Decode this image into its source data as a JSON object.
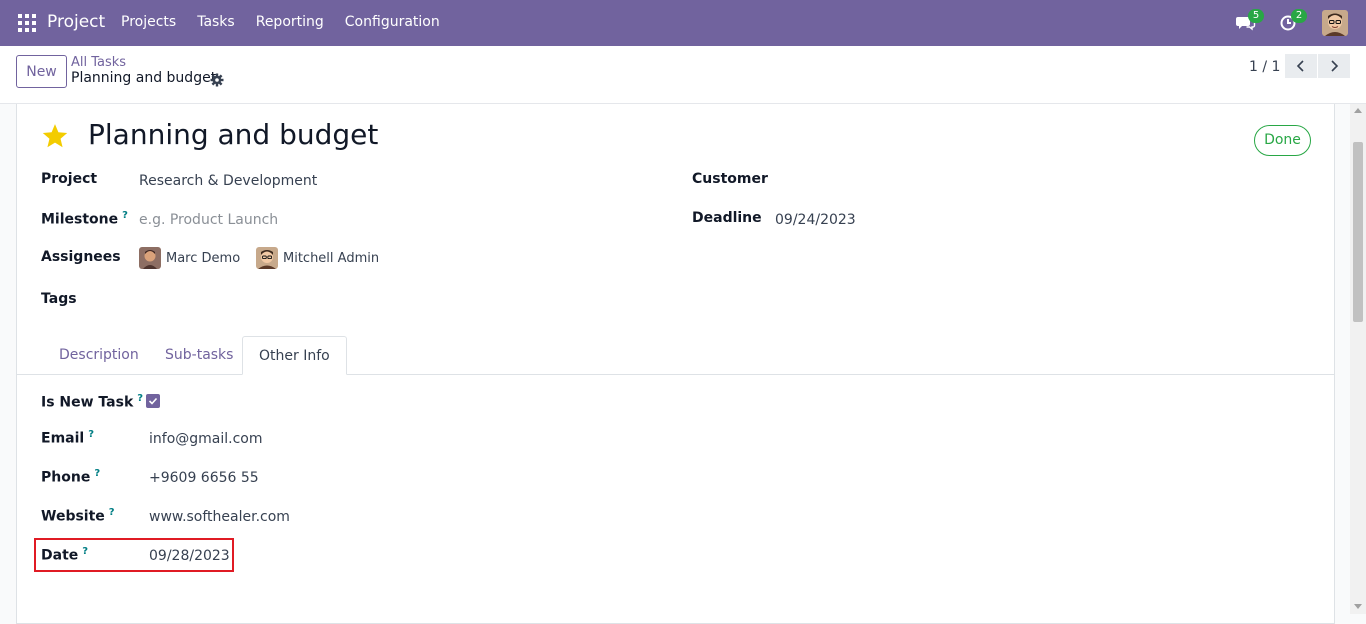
{
  "navbar": {
    "brand": "Project",
    "menu": [
      "Projects",
      "Tasks",
      "Reporting",
      "Configuration"
    ],
    "messages_badge": "5",
    "activities_badge": "2"
  },
  "control": {
    "new_label": "New",
    "breadcrumb_parent": "All Tasks",
    "breadcrumb_current": "Planning and budget",
    "pager": "1 / 1"
  },
  "task": {
    "title": "Planning and budget",
    "status": "Done",
    "fields_left": {
      "project_label": "Project",
      "project_value": "Research & Development",
      "milestone_label": "Milestone",
      "milestone_placeholder": "e.g. Product Launch",
      "assignees_label": "Assignees",
      "assignees": [
        "Marc Demo",
        "Mitchell Admin"
      ],
      "tags_label": "Tags"
    },
    "fields_right": {
      "customer_label": "Customer",
      "deadline_label": "Deadline",
      "deadline_value": "09/24/2023"
    },
    "help_mark": "?"
  },
  "tabs": [
    "Description",
    "Sub-tasks",
    "Other Info"
  ],
  "other_info": {
    "is_new_task_label": "Is New Task",
    "is_new_task_checked": true,
    "email_label": "Email",
    "email_value": "info@gmail.com",
    "phone_label": "Phone",
    "phone_value": "+9609 6656 55",
    "website_label": "Website",
    "website_value": "www.softhealer.com",
    "date_label": "Date",
    "date_value": "09/28/2023"
  },
  "colors": {
    "brand": "#71639e",
    "success": "#28a745",
    "star": "#f3cc00",
    "highlight": "#e01b24"
  }
}
